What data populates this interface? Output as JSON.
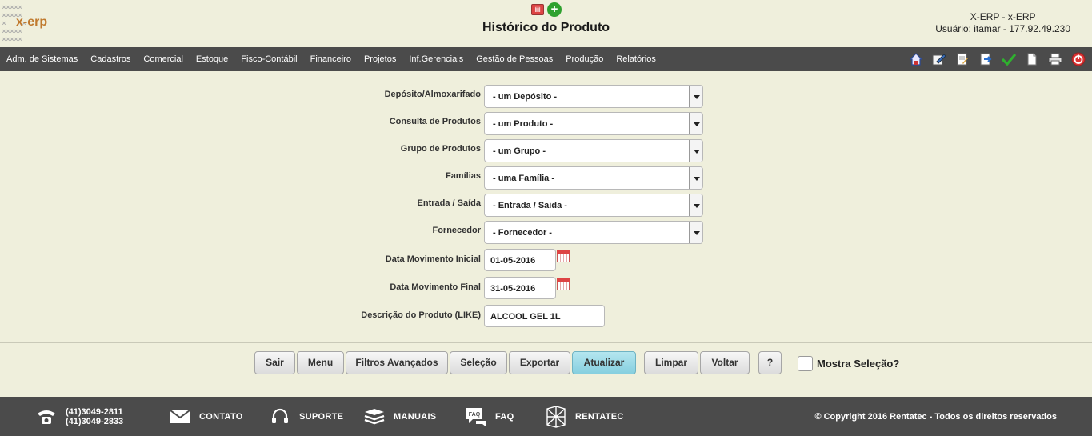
{
  "header": {
    "title": "Histórico do Produto",
    "system": "X-ERP - x-ERP",
    "user": "Usuário: itamar - 177.92.49.230",
    "logo_text": "x-erp",
    "icons": [
      "pdf-icon",
      "add-icon"
    ]
  },
  "menu": {
    "items": [
      "Adm. de Sistemas",
      "Cadastros",
      "Comercial",
      "Estoque",
      "Fisco-Contábil",
      "Financeiro",
      "Projetos",
      "Inf.Gerenciais",
      "Gestão de Pessoas",
      "Produção",
      "Relatórios"
    ],
    "tools": [
      "home-icon",
      "edit-icon",
      "document-edit-icon",
      "export-icon",
      "check-icon",
      "new-document-icon",
      "print-icon",
      "power-icon"
    ]
  },
  "form": {
    "deposito": {
      "label": "Depósito/Almoxarifado",
      "value": "- um Depósito -"
    },
    "produto": {
      "label": "Consulta de Produtos",
      "value": "- um Produto -"
    },
    "grupo": {
      "label": "Grupo de Produtos",
      "value": "- um Grupo -"
    },
    "familia": {
      "label": "Famílias",
      "value": "- uma Família -"
    },
    "entrada": {
      "label": "Entrada / Saída",
      "value": "- Entrada / Saída -"
    },
    "fornecedor": {
      "label": "Fornecedor",
      "value": "- Fornecedor -"
    },
    "data_inicial": {
      "label": "Data Movimento Inicial",
      "value": "01-05-2016"
    },
    "data_final": {
      "label": "Data Movimento Final",
      "value": "31-05-2016"
    },
    "descricao": {
      "label": "Descrição do Produto (LIKE)",
      "value": "ALCOOL GEL 1L"
    }
  },
  "buttons": {
    "sair": "Sair",
    "menu": "Menu",
    "filtros": "Filtros Avançados",
    "selecao": "Seleção",
    "exportar": "Exportar",
    "atualizar": "Atualizar",
    "limpar": "Limpar",
    "voltar": "Voltar",
    "help": "?",
    "mostra_selecao": "Mostra Seleção?"
  },
  "footer": {
    "phone1": "(41)3049-2811",
    "phone2": "(41)3049-2833",
    "contato": "CONTATO",
    "suporte": "SUPORTE",
    "manuais": "MANUAIS",
    "faq": "FAQ",
    "faq_icon_text": "FAQ",
    "rentatec": "RENTATEC",
    "copyright": "© Copyright 2016 Rentatec - Todos os direitos reservados"
  },
  "colors": {
    "background": "#efefdc",
    "bar": "#4b4b4b",
    "active_button": "#9fdbe8"
  }
}
